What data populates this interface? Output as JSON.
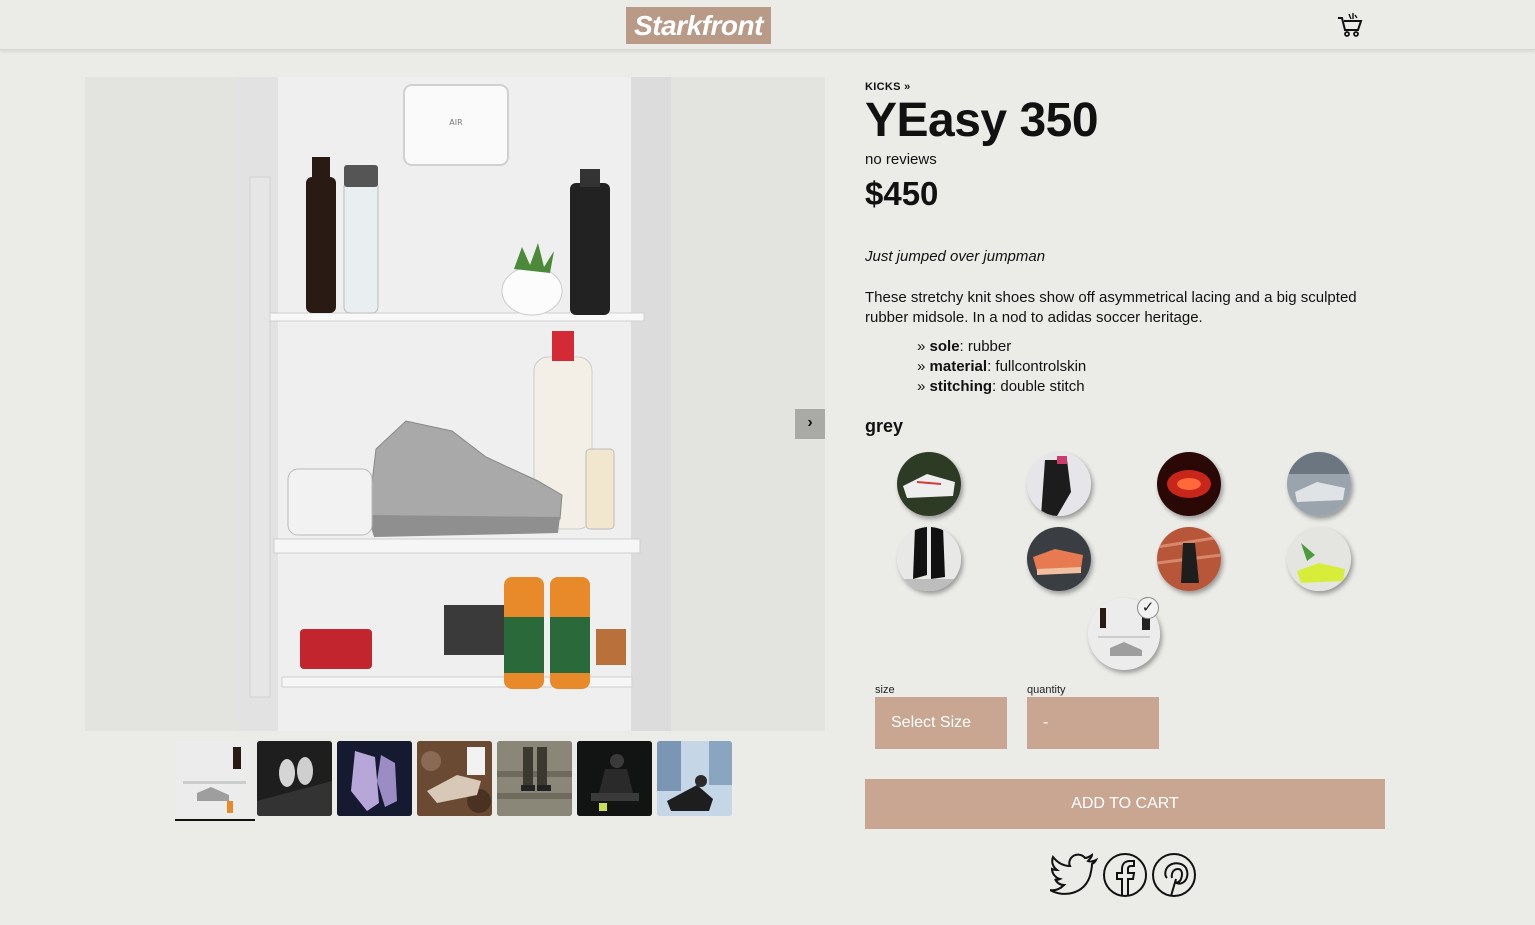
{
  "header": {
    "logo_text": "Starkfront",
    "cart_icon": "cart-icon"
  },
  "gallery": {
    "next_icon": "›",
    "thumbnails": [
      "fridge sneaker",
      "sneakers on dark",
      "purple sneakers",
      "sneakers on rocks",
      "sneakers on steps",
      "man sitting",
      "man on street"
    ]
  },
  "product": {
    "breadcrumb": "KICKS »",
    "title": "YEasy 350",
    "reviews": "no reviews",
    "price": "$450",
    "tagline": "Just jumped over jumpman",
    "description": "These stretchy knit shoes show off asymmetrical lacing and a big sculpted rubber midsole. In a nod to adidas soccer heritage.",
    "specs": [
      {
        "prefix": "» ",
        "key": "sole",
        "value": ": rubber"
      },
      {
        "prefix": "» ",
        "key": "material",
        "value": ": fullcontrolskin"
      },
      {
        "prefix": "» ",
        "key": "stitching",
        "value": ": double stitch"
      }
    ],
    "selected_color": "grey",
    "selected_check": "✓",
    "size": {
      "label": "size",
      "value": "Select Size"
    },
    "quantity": {
      "label": "quantity",
      "value": "-"
    },
    "add_to_cart": "ADD TO CART"
  },
  "colors": {
    "accent": "#c9a692",
    "logo_bg": "#b89a87",
    "page_bg": "#ebebe8"
  },
  "social": [
    "twitter-icon",
    "facebook-icon",
    "pinterest-icon"
  ]
}
